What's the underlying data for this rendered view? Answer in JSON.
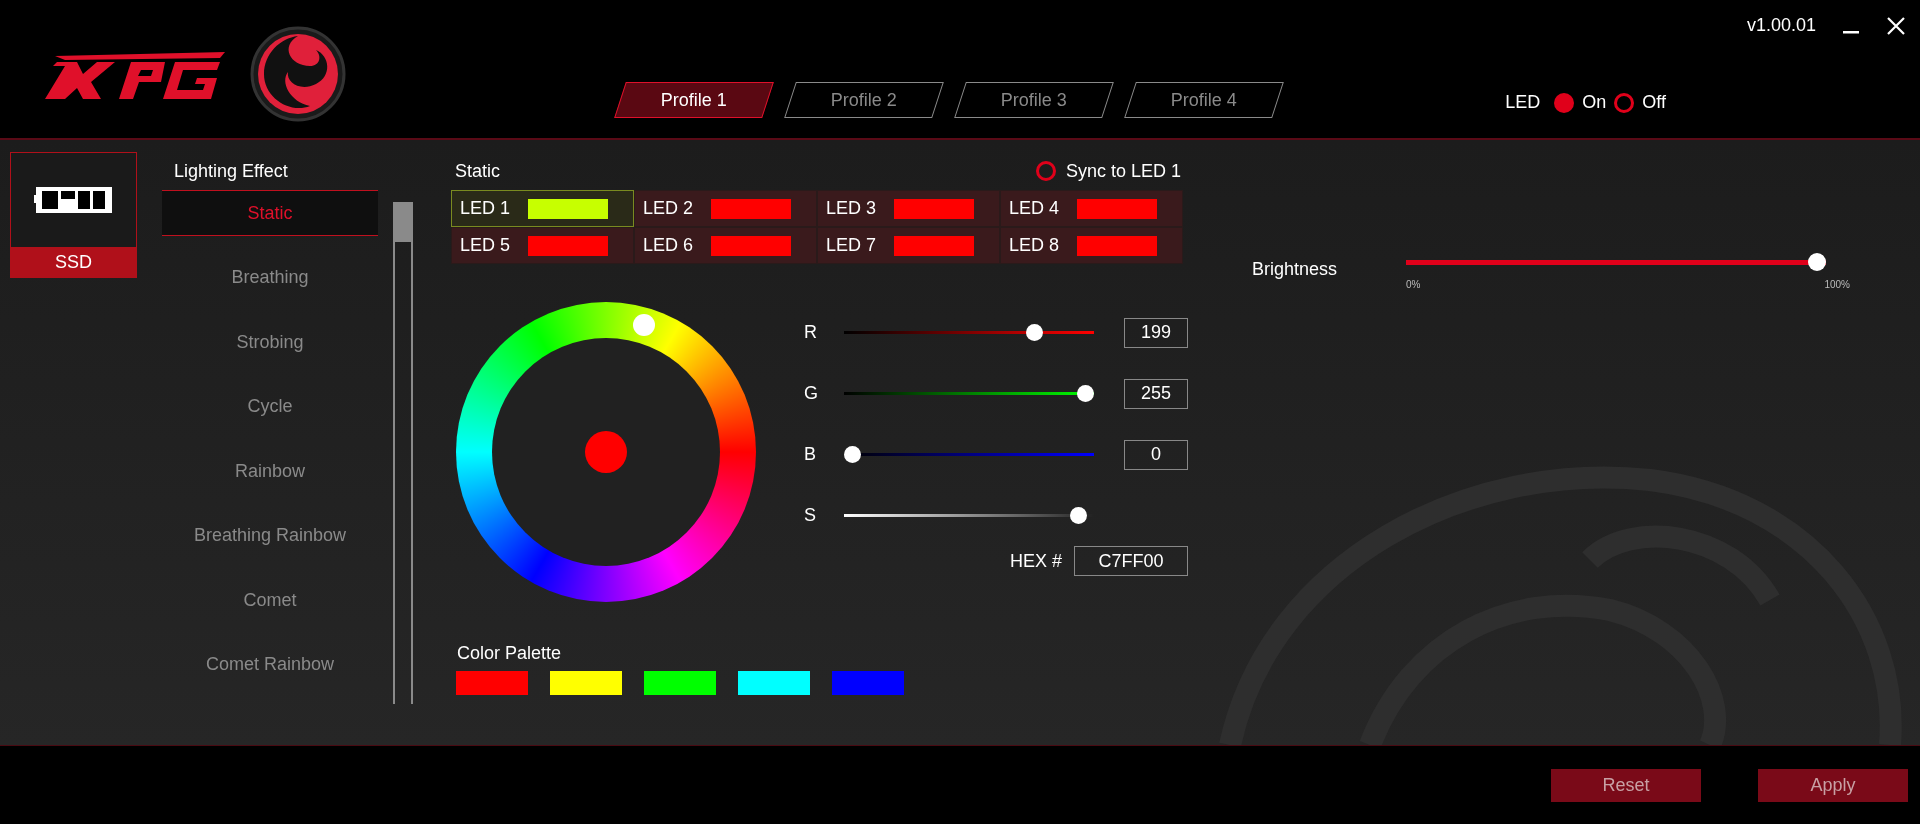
{
  "window": {
    "version": "v1.00.01"
  },
  "profiles": [
    {
      "label": "Profile 1",
      "selected": true
    },
    {
      "label": "Profile 2",
      "selected": false
    },
    {
      "label": "Profile 3",
      "selected": false
    },
    {
      "label": "Profile 4",
      "selected": false
    }
  ],
  "led_power": {
    "label": "LED",
    "options": [
      {
        "label": "On",
        "selected": true
      },
      {
        "label": "Off",
        "selected": false
      }
    ]
  },
  "device": {
    "label": "SSD",
    "selected": true
  },
  "lighting_effect": {
    "title": "Lighting Effect",
    "effects": [
      {
        "label": "Static",
        "selected": true
      },
      {
        "label": "Breathing",
        "selected": false
      },
      {
        "label": "Strobing",
        "selected": false
      },
      {
        "label": "Cycle",
        "selected": false
      },
      {
        "label": "Rainbow",
        "selected": false
      },
      {
        "label": "Breathing Rainbow",
        "selected": false
      },
      {
        "label": "Comet",
        "selected": false
      },
      {
        "label": "Comet Rainbow",
        "selected": false
      }
    ]
  },
  "static_panel": {
    "title": "Static",
    "sync": {
      "label": "Sync to LED 1",
      "checked": false
    },
    "leds": [
      {
        "label": "LED 1",
        "color": "#c7ff00",
        "selected": true
      },
      {
        "label": "LED 2",
        "color": "#ff0000",
        "selected": false
      },
      {
        "label": "LED 3",
        "color": "#ff0000",
        "selected": false
      },
      {
        "label": "LED 4",
        "color": "#ff0000",
        "selected": false
      },
      {
        "label": "LED 5",
        "color": "#ff0000",
        "selected": false
      },
      {
        "label": "LED 6",
        "color": "#ff0000",
        "selected": false
      },
      {
        "label": "LED 7",
        "color": "#ff0000",
        "selected": false
      },
      {
        "label": "LED 8",
        "color": "#ff0000",
        "selected": false
      }
    ]
  },
  "color_picker": {
    "channels": [
      {
        "kind": "red",
        "label": "R",
        "level": 0.78,
        "value": "199"
      },
      {
        "kind": "green",
        "label": "G",
        "level": 1,
        "value": "255"
      },
      {
        "kind": "blue",
        "label": "B",
        "level": 0,
        "value": "0"
      },
      {
        "kind": "saturation",
        "label": "S",
        "level": 0.97
      }
    ],
    "hex_label": "HEX #",
    "hex_value": "C7FF00"
  },
  "brightness": {
    "label": "Brightness",
    "level": 1,
    "min_label": "0%",
    "max_label": "100%"
  },
  "palette": {
    "title": "Color Palette",
    "colors": [
      {
        "color": "#ff0000"
      },
      {
        "color": "#ffff00"
      },
      {
        "color": "#00ff00"
      },
      {
        "color": "#00ffff"
      },
      {
        "color": "#0000ff"
      }
    ]
  },
  "buttons": [
    {
      "label": "Reset"
    },
    {
      "label": "Apply"
    }
  ]
}
